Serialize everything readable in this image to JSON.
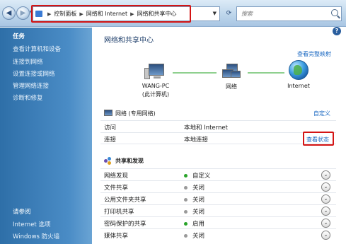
{
  "address_bar": {
    "crumbs": [
      "控制面板",
      "网络和 Internet",
      "网络和共享中心"
    ]
  },
  "search": {
    "placeholder": "搜索"
  },
  "sidebar": {
    "tasks_heading": "任务",
    "tasks": [
      "查看计算机和设备",
      "连接到网络",
      "设置连接或网络",
      "管理网络连接",
      "诊断和修复"
    ],
    "see_also_heading": "请参阅",
    "see_also": [
      "Internet 选项",
      "Windows 防火墙"
    ]
  },
  "main": {
    "help_label": "?",
    "title": "网络和共享中心",
    "view_full_map": "查看完整映射",
    "map": {
      "computer_name": "WANG-PC",
      "computer_sub": "(此计算机)",
      "network_label": "网络",
      "internet_label": "Internet"
    },
    "network_section": {
      "title": "网络 (专用网络)",
      "customize": "自定义",
      "rows": [
        {
          "key": "访问",
          "value": "本地和 Internet"
        },
        {
          "key": "连接",
          "value": "本地连接"
        }
      ],
      "view_status": "查看状态"
    },
    "sharing": {
      "title": "共享和发现",
      "rows": [
        {
          "key": "网络发现",
          "value": "自定义",
          "on": true
        },
        {
          "key": "文件共享",
          "value": "关闭",
          "on": false
        },
        {
          "key": "公用文件夹共享",
          "value": "关闭",
          "on": false
        },
        {
          "key": "打印机共享",
          "value": "关闭",
          "on": false
        },
        {
          "key": "密码保护的共享",
          "value": "启用",
          "on": true
        },
        {
          "key": "媒体共享",
          "value": "关闭",
          "on": false
        }
      ]
    }
  },
  "colors": {
    "sidebar": "#3d80bd",
    "link": "#1565c0",
    "highlight_box": "#d41414",
    "on_dot": "#2aa42a"
  }
}
